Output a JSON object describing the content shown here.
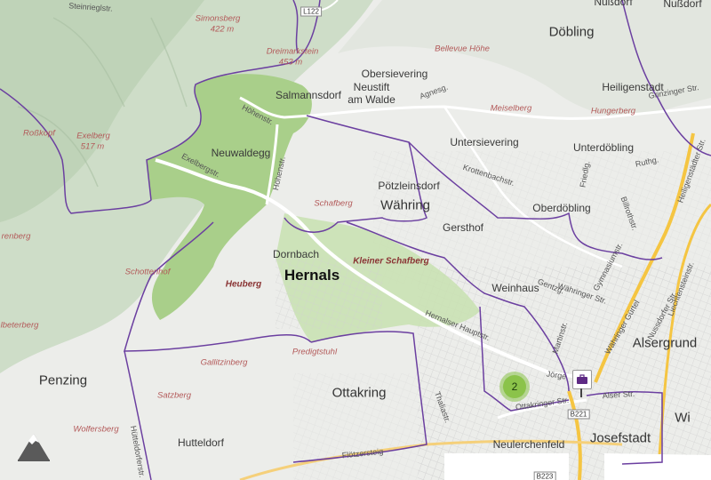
{
  "map": {
    "districts": {
      "doebling": "Döbling",
      "waehring": "Währing",
      "hernals": "Hernals",
      "ottakring": "Ottakring",
      "penzing": "Penzing",
      "alsergrund": "Alsergrund",
      "josefstadt": "Josefstadt",
      "wien_partial": "Wi"
    },
    "suburbs": {
      "salmannsdorf": "Salmannsdorf",
      "neuwaldegg": "Neuwaldegg",
      "dornbach": "Dornbach",
      "obersievering": "Obersievering",
      "neustift": "Neustift",
      "am_walde": "am Walde",
      "untersievering": "Untersievering",
      "unterdoebling": "Unterdöbling",
      "heiligenstadt": "Heiligenstadt",
      "poetzleinsdorf": "Pötzleinsdorf",
      "gersthof": "Gersthof",
      "oberdoebling": "Oberdöbling",
      "weinhaus": "Weinhaus",
      "hutteldorf": "Hutteldorf",
      "neulerchenfeld": "Neulerchenfeld",
      "nussdorf": "Nußdorf",
      "nussdorf_partial": "Nußdorf"
    },
    "peaks": {
      "simonsberg": "Simonsberg",
      "simonsberg_el": "422 m",
      "dreimarkstein": "Dreimarkstein",
      "dreimarkstein_el": "453 m",
      "exelberg": "Exelberg",
      "exelberg_el": "517 m",
      "rosskopf": "Roßkopf",
      "bellevue": "Bellevue Höhe",
      "meiselberg": "Meiselberg",
      "hungerberg": "Hungerberg",
      "schafberg": "Schafberg",
      "kleiner_schafberg": "Kleiner Schafberg",
      "heuberg": "Heuberg",
      "schottenhof": "Schottenhof",
      "gallitzinberg": "Gallitzinberg",
      "predigtstuhl": "Predigtstuhl",
      "satzberg": "Satzberg",
      "wolfersberg": "Wolfersberg",
      "renberg": "renberg",
      "ebeterg": "lbeterberg"
    },
    "streets": {
      "steinriegl": "Steinriegl­str.",
      "hoehenstr": "Höhenstr.",
      "hoehenstr2": "Höhenstr.",
      "exelbergstr": "Exelbergstr.",
      "hernalser_hauptstr": "Hernalser Hauptstr.",
      "joerger": "Jörge",
      "ottakringer": "Ottakringer Str.",
      "flotzersteig": "Flötzersteig",
      "agnesg": "Agnesg.",
      "krottenbach": "Krottenbachstr.",
      "grinzinger": "Grinzinger Str.",
      "waehringer": "Währinger Str.",
      "gentzg": "Gentzg.",
      "gymnasiumstr": "Gymnasiumstr.",
      "thaliastr": "Thaliastr.",
      "hutteldorfer": "Hütteldorfer­str.",
      "heiligenstaedter": "Heiligenstädter Str.",
      "billrothstr": "Billrothstr.",
      "liechtensteinstr": "Liechtensteinstr.",
      "nussdorfer": "Nussdorfer Str.",
      "alser": "Alser Str.",
      "friedlg": "Friedlg.",
      "martinstr": "Martinstr.",
      "ruthg": "Ruthg.",
      "guertel": "Währinger Gürtel"
    },
    "shields": {
      "l122": "L122",
      "b221": "B221",
      "b223": "B223"
    },
    "cluster": {
      "count": "2",
      "color": "#8bc34a"
    },
    "poi": {
      "icon": "briefcase-icon",
      "color": "#5e2a84"
    },
    "logo": {
      "icon": "mountain-logo-icon"
    },
    "colors": {
      "background": "#f0f0ee",
      "forest": "#a9cf8a",
      "hills": "#c9d9c2",
      "boundary": "#6b3fa0",
      "major_road": "#f5c542",
      "peak_label": "#b35a5a"
    }
  }
}
